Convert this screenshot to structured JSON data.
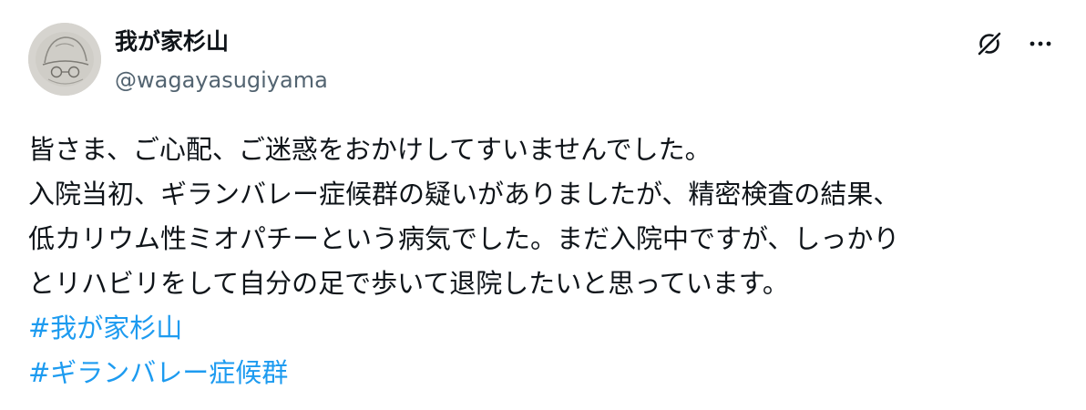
{
  "post": {
    "author": {
      "display_name": "我が家杉山",
      "handle": "@wagayasugiyama",
      "avatar_icon": "avatar-photo"
    },
    "actions": {
      "grok_icon": "grok-icon",
      "more_icon": "more-icon"
    },
    "body_lines": [
      "皆さま、ご心配、ご迷惑をおかけしてすいませんでした。",
      "入院当初、ギランバレー症候群の疑いがありましたが、精密検査の結果、",
      "低カリウム性ミオパチーという病気でした。まだ入院中ですが、しっかり",
      "とリハビリをして自分の足で歩いて退院したいと思っています。"
    ],
    "hashtags": [
      "#我が家杉山",
      "#ギランバレー症候群"
    ]
  },
  "colors": {
    "text": "#0f1419",
    "secondary": "#536471",
    "link": "#1d9bf0"
  }
}
